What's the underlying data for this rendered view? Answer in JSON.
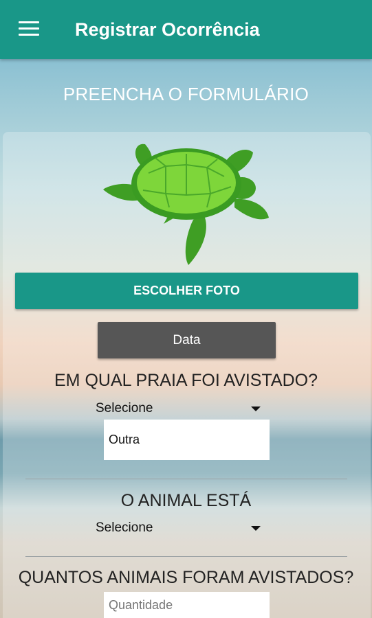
{
  "app_bar": {
    "title": "Registrar Ocorrência",
    "menu_icon": "hamburger-menu-icon",
    "color": "#199788"
  },
  "form": {
    "heading": "PREENCHA O FORMULÁRIO",
    "image_icon": "sea-turtle-image",
    "photo_button": "ESCOLHER FOTO",
    "date_button": "Data",
    "beach_question": "EM QUAL PRAIA FOI AVISTADO?",
    "beach_select_value": "Selecione",
    "beach_other_value": "Outra",
    "status_question": "O ANIMAL ESTÁ",
    "status_select_value": "Selecione",
    "quantity_question": "QUANTOS ANIMAIS FORAM AVISTADOS?",
    "quantity_placeholder": "Quantidade"
  },
  "colors": {
    "accent": "#199788",
    "date_button": "#565656"
  }
}
